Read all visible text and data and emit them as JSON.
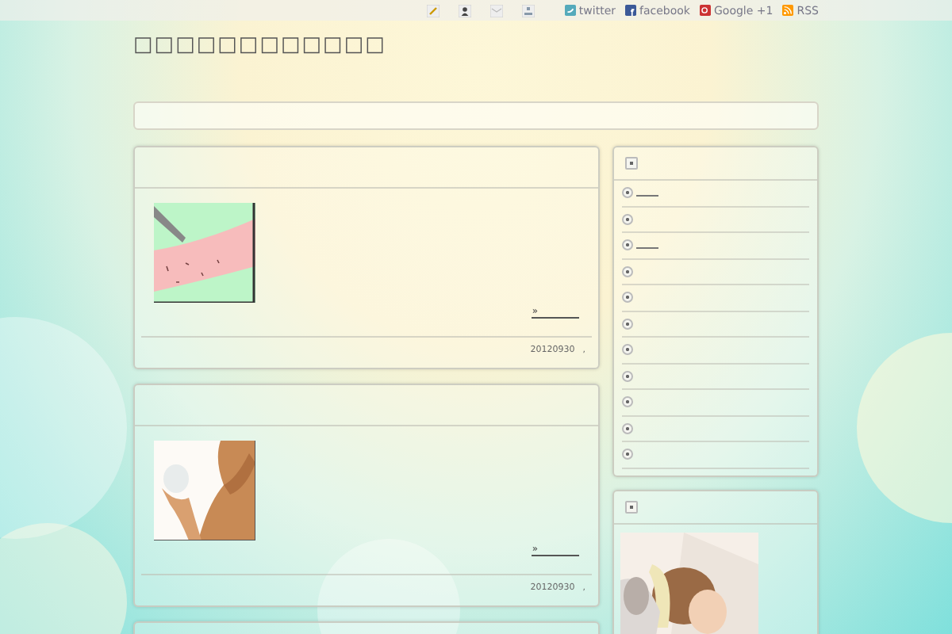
{
  "topbar": {
    "icons": [
      {
        "kind": "pencil"
      },
      {
        "kind": "person"
      },
      {
        "kind": "mail"
      },
      {
        "kind": "tree"
      }
    ],
    "links": [
      {
        "kind": "twitter",
        "label": "twitter"
      },
      {
        "kind": "facebook",
        "label": "facebook"
      },
      {
        "kind": "google",
        "label": "Google +1"
      },
      {
        "kind": "rss",
        "label": "RSS"
      }
    ]
  },
  "site_title": "□□□□□□□□□□□□",
  "posts": [
    {
      "kind": "drawing",
      "more": "»",
      "date": "20120930",
      "comma": ","
    },
    {
      "kind": "picture",
      "more": "»",
      "date": "20120930",
      "comma": ","
    }
  ],
  "sidebar": {
    "widgets": [
      {
        "kind": "list",
        "items": [
          {
            "link": true
          },
          {
            "link": false
          },
          {
            "link": true
          },
          {
            "link": false
          },
          {
            "link": false
          },
          {
            "link": false
          },
          {
            "link": false
          },
          {
            "link": false
          },
          {
            "link": false
          },
          {
            "link": false
          },
          {
            "link": false
          }
        ]
      },
      {
        "kind": "picture"
      }
    ]
  }
}
